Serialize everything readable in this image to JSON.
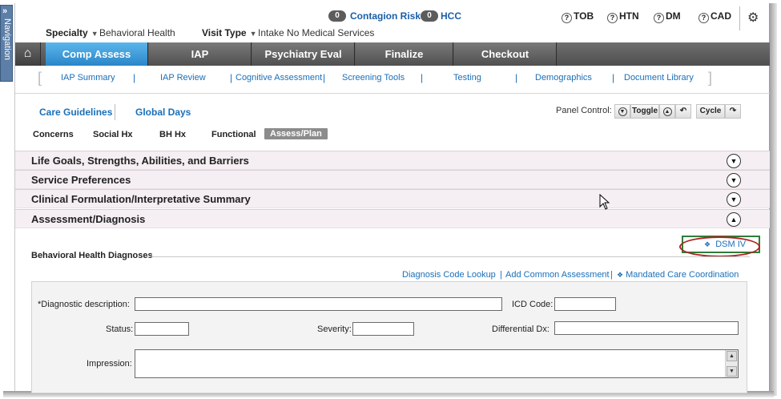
{
  "nav_strip": {
    "label": "Navigation",
    "expand_glyph": "»"
  },
  "top": {
    "contagion": {
      "count": "0",
      "label": "Contagion Risk"
    },
    "hcc": {
      "count": "0",
      "label": "HCC"
    },
    "quick": [
      {
        "icon": "?",
        "label": "TOB"
      },
      {
        "icon": "?",
        "label": "HTN"
      },
      {
        "icon": "?",
        "label": "DM"
      },
      {
        "icon": "?",
        "label": "CAD"
      }
    ],
    "settings_icon": "gear-icon"
  },
  "context": {
    "specialty_label": "Specialty",
    "specialty_value": "Behavioral Health",
    "visit_type_label": "Visit Type",
    "visit_type_value": "Intake No Medical Services"
  },
  "main_tabs": [
    {
      "label": "Comp Assess",
      "active": true
    },
    {
      "label": "IAP",
      "active": false
    },
    {
      "label": "Psychiatry Eval",
      "active": false
    },
    {
      "label": "Finalize",
      "active": false
    },
    {
      "label": "Checkout",
      "active": false
    }
  ],
  "sub_nav": [
    "IAP Summary",
    "IAP Review",
    "Cognitive Assessment",
    "Screening Tools",
    "Testing",
    "Demographics",
    "Document Library"
  ],
  "care": {
    "guidelines": "Care Guidelines",
    "global_days": "Global Days",
    "panel_control_label": "Panel Control:",
    "toggle": "Toggle",
    "cycle": "Cycle"
  },
  "section_tabs": [
    {
      "label": "Concerns",
      "active": false
    },
    {
      "label": "Social Hx",
      "active": false
    },
    {
      "label": "BH Hx",
      "active": false
    },
    {
      "label": "Functional",
      "active": false
    },
    {
      "label": "Assess/Plan",
      "active": true
    }
  ],
  "accordion": [
    {
      "label": "Life Goals, Strengths, Abilities, and Barriers",
      "state": "collapsed"
    },
    {
      "label": "Service Preferences",
      "state": "collapsed"
    },
    {
      "label": "Clinical Formulation/Interpretative Summary",
      "state": "collapsed"
    },
    {
      "label": "Assessment/Diagnosis",
      "state": "expanded"
    }
  ],
  "diagnoses": {
    "dsm_link": "DSM IV",
    "title": "Behavioral Health Diagnoses",
    "actions": [
      "Diagnosis Code Lookup",
      "Add Common Assessment",
      "Mandated Care Coordination"
    ],
    "form": {
      "diag_desc_label": "*Diagnostic description:",
      "icd_label": "ICD Code:",
      "status_label": "Status:",
      "severity_label": "Severity:",
      "diff_dx_label": "Differential Dx:",
      "impression_label": "Impression:"
    }
  },
  "colors": {
    "active_tab": "#2a86c8",
    "link": "#1a6fb8",
    "accordion_bg": "#f5eef2",
    "highlight_ellipse": "#b02222",
    "highlight_box": "#2e7d3a"
  }
}
